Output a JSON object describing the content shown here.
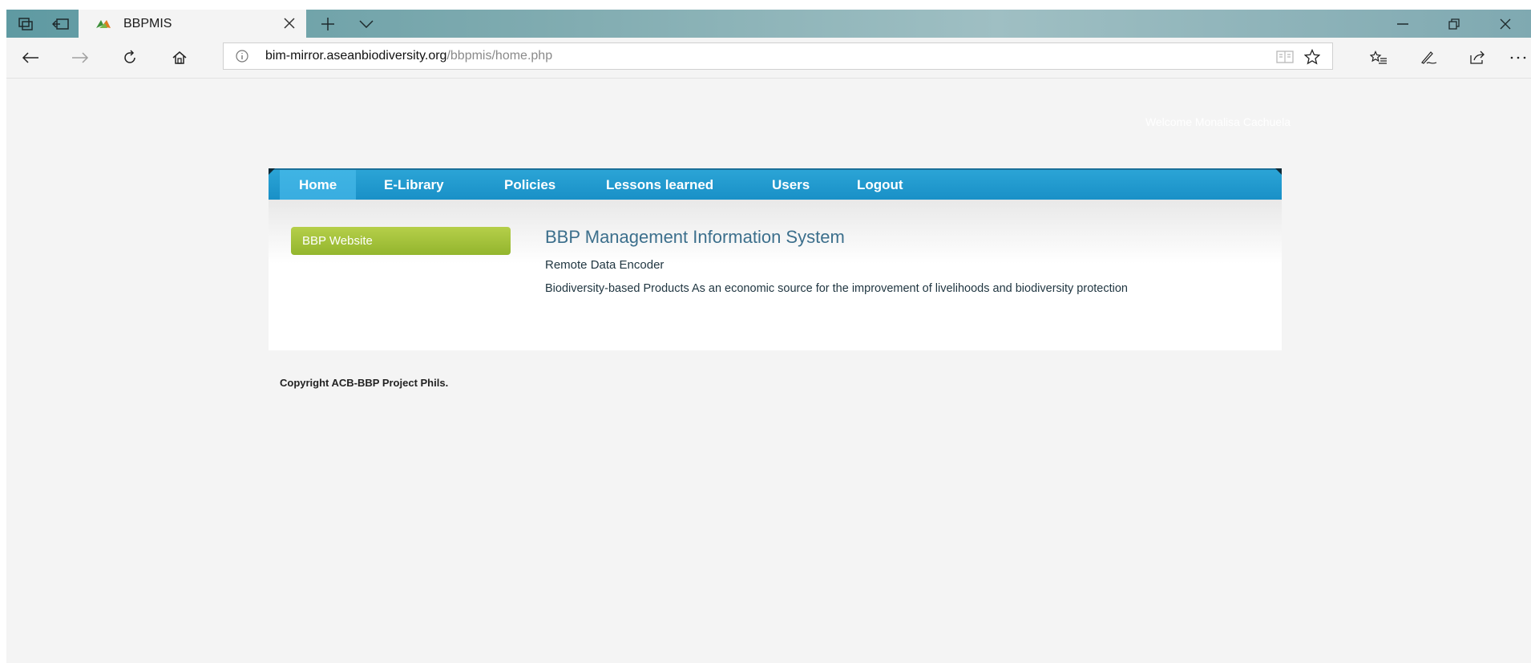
{
  "browser": {
    "tab_title": "BBPMIS",
    "address": {
      "domain": "bim-mirror.aseanbiodiversity.org",
      "path": "/bbpmis/home.php"
    }
  },
  "page": {
    "welcome": "Welcome Monalisa Cachuela",
    "menu": [
      {
        "label": "Home"
      },
      {
        "label": "E-Library"
      },
      {
        "label": "Policies"
      },
      {
        "label": "Lessons learned"
      },
      {
        "label": "Users"
      },
      {
        "label": "Logout"
      }
    ],
    "sidebar_button": "BBP Website",
    "title": "BBP Management Information System",
    "subtitle": "Remote Data Encoder",
    "description": "Biodiversity-based Products As an economic source for the improvement of livelihoods and biodiversity protection",
    "copyright": "Copyright ACB-BBP Project Phils."
  },
  "colors": {
    "menu_bar": "#1990c7",
    "side_button": "#a3c33a",
    "title_text": "#3c6f8c"
  }
}
